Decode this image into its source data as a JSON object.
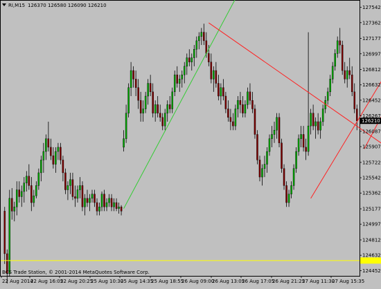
{
  "header": {
    "collapse_icon": "triangle-down-icon",
    "symbol_tf": "RI,M15",
    "ohlc": "126370 126580 126090 126210"
  },
  "footer": {
    "copyright": "BCS Trade Station, © 2001-2014 MetaQuotes Software Corp."
  },
  "colors": {
    "background": "#c0c0c0",
    "bull_candle": "#00aa00",
    "bear_candle": "#800000",
    "wick": "#000000",
    "trendline_green": "#33cc33",
    "trendline_red": "#ff2020",
    "horizontal_line": "#ffff00",
    "price_badge_bg": "#000000",
    "price_badge_text": "#ffffff"
  },
  "chart_data": {
    "type": "candlestick",
    "y_ticks": [
      "127542",
      "127362",
      "127177",
      "126997",
      "126812",
      "126632",
      "126452",
      "126267",
      "126087",
      "125907",
      "125722",
      "125542",
      "125362",
      "125177",
      "124997",
      "124812",
      "124632",
      "124452"
    ],
    "y_range": [
      124390,
      127620
    ],
    "current_price_label": "126210",
    "current_price": 126210,
    "yellow_level": 124570,
    "x_labels": [
      "22 Aug 2014",
      "22 Aug 16:05",
      "22 Aug 20:25",
      "25 Aug 10:30",
      "25 Aug 14:35",
      "25 Aug 18:55",
      "26 Aug 09:00",
      "26 Aug 13:05",
      "26 Aug 17:05",
      "26 Aug 21:25",
      "27 Aug 11:30",
      "27 Aug 15:35"
    ],
    "bars": [
      [
        125150,
        125200,
        124530,
        124650
      ],
      [
        124650,
        124700,
        124300,
        124420
      ],
      [
        124420,
        125400,
        124380,
        125300
      ],
      [
        125300,
        125420,
        125050,
        125150
      ],
      [
        125150,
        125260,
        125030,
        125200
      ],
      [
        125200,
        125500,
        125100,
        125400
      ],
      [
        125400,
        125500,
        125250,
        125320
      ],
      [
        125320,
        125450,
        125200,
        125380
      ],
      [
        125380,
        125550,
        125250,
        125480
      ],
      [
        125480,
        125620,
        125380,
        125560
      ],
      [
        125560,
        125700,
        125400,
        125450
      ],
      [
        125450,
        125550,
        125150,
        125250
      ],
      [
        125250,
        125400,
        125200,
        125330
      ],
      [
        125330,
        125500,
        125300,
        125450
      ],
      [
        125450,
        125650,
        125400,
        125600
      ],
      [
        125600,
        125800,
        125500,
        125750
      ],
      [
        125750,
        125950,
        125600,
        125850
      ],
      [
        125850,
        126050,
        125750,
        126000
      ],
      [
        126000,
        126200,
        125850,
        125900
      ],
      [
        125900,
        126000,
        125750,
        125800
      ],
      [
        125800,
        125900,
        125650,
        125700
      ],
      [
        125700,
        125900,
        125600,
        125850
      ],
      [
        125850,
        125950,
        125750,
        125900
      ],
      [
        125900,
        125950,
        125700,
        125750
      ],
      [
        125750,
        125800,
        125500,
        125600
      ],
      [
        125600,
        125650,
        125350,
        125400
      ],
      [
        125400,
        125500,
        125280,
        125450
      ],
      [
        125450,
        125600,
        125350,
        125520
      ],
      [
        125520,
        125600,
        125280,
        125320
      ],
      [
        125320,
        125450,
        125200,
        125300
      ],
      [
        125300,
        125450,
        125250,
        125400
      ],
      [
        125400,
        125550,
        125300,
        125450
      ],
      [
        125450,
        125500,
        125150,
        125200
      ],
      [
        125200,
        125350,
        125100,
        125300
      ],
      [
        125300,
        125400,
        125200,
        125250
      ],
      [
        125250,
        125350,
        125150,
        125300
      ],
      [
        125300,
        125400,
        125250,
        125350
      ],
      [
        125350,
        125400,
        125200,
        125250
      ],
      [
        125250,
        125300,
        125100,
        125150
      ],
      [
        125150,
        125250,
        125100,
        125200
      ],
      [
        125200,
        125380,
        125150,
        125350
      ],
      [
        125350,
        125400,
        125150,
        125200
      ],
      [
        125200,
        125300,
        125150,
        125250
      ],
      [
        125250,
        125350,
        125200,
        125300
      ],
      [
        125300,
        125350,
        125150,
        125200
      ],
      [
        125200,
        125300,
        125150,
        125250
      ],
      [
        125250,
        125300,
        125150,
        125180
      ],
      [
        125180,
        125250,
        125120,
        125200
      ],
      [
        125200,
        125220,
        125100,
        125150
      ],
      [
        125900,
        126100,
        125850,
        126000
      ],
      [
        126000,
        126400,
        125950,
        126300
      ],
      [
        126300,
        126650,
        126250,
        126600
      ],
      [
        126600,
        126900,
        126500,
        126800
      ],
      [
        126800,
        126850,
        126600,
        126700
      ],
      [
        126700,
        126800,
        126500,
        126600
      ],
      [
        126600,
        126700,
        126350,
        126450
      ],
      [
        126450,
        126550,
        126200,
        126300
      ],
      [
        126300,
        126450,
        126200,
        126350
      ],
      [
        126350,
        126550,
        126300,
        126500
      ],
      [
        126500,
        126700,
        126400,
        126650
      ],
      [
        126650,
        126750,
        126500,
        126550
      ],
      [
        126550,
        126650,
        126250,
        126300
      ],
      [
        126300,
        126450,
        126200,
        126400
      ],
      [
        126400,
        126500,
        126250,
        126300
      ],
      [
        126300,
        126400,
        126200,
        126250
      ],
      [
        126250,
        126300,
        126100,
        126150
      ],
      [
        126150,
        126350,
        126100,
        126300
      ],
      [
        126300,
        126450,
        126200,
        126400
      ],
      [
        126400,
        126500,
        126300,
        126350
      ],
      [
        126350,
        126600,
        126300,
        126550
      ],
      [
        126550,
        126800,
        126500,
        126750
      ],
      [
        126750,
        126850,
        126600,
        126650
      ],
      [
        126650,
        126750,
        126550,
        126700
      ],
      [
        126700,
        126800,
        126600,
        126750
      ],
      [
        126750,
        126900,
        126650,
        126850
      ],
      [
        126850,
        127000,
        126750,
        126950
      ],
      [
        126950,
        127050,
        126850,
        126900
      ],
      [
        126900,
        127000,
        126800,
        126950
      ],
      [
        126950,
        127100,
        126850,
        127050
      ],
      [
        127050,
        127200,
        126950,
        127150
      ],
      [
        127150,
        127250,
        127050,
        127200
      ],
      [
        127200,
        127300,
        127100,
        127250
      ],
      [
        127250,
        127350,
        127100,
        127150
      ],
      [
        127150,
        127250,
        126950,
        127000
      ],
      [
        127000,
        127100,
        126850,
        126900
      ],
      [
        126900,
        127000,
        126650,
        126700
      ],
      [
        126700,
        126850,
        126550,
        126800
      ],
      [
        126800,
        126900,
        126600,
        126650
      ],
      [
        126650,
        126750,
        126450,
        126500
      ],
      [
        126500,
        126650,
        126400,
        126600
      ],
      [
        126600,
        126700,
        126450,
        126500
      ],
      [
        126500,
        126550,
        126300,
        126350
      ],
      [
        126350,
        126450,
        126200,
        126250
      ],
      [
        126250,
        126350,
        126100,
        126200
      ],
      [
        126200,
        126300,
        126100,
        126150
      ],
      [
        126150,
        126400,
        126100,
        126350
      ],
      [
        126350,
        126500,
        126250,
        126450
      ],
      [
        126450,
        126550,
        126300,
        126400
      ],
      [
        126400,
        126500,
        126250,
        126300
      ],
      [
        126300,
        126450,
        126250,
        126400
      ],
      [
        126400,
        126600,
        126350,
        126550
      ],
      [
        126550,
        126650,
        126400,
        126450
      ],
      [
        126450,
        126550,
        126300,
        126350
      ],
      [
        126350,
        126400,
        126000,
        126050
      ],
      [
        126050,
        126100,
        125700,
        125750
      ],
      [
        125750,
        125800,
        125500,
        125550
      ],
      [
        125550,
        125700,
        125450,
        125650
      ],
      [
        125650,
        125800,
        125550,
        125700
      ],
      [
        125700,
        125900,
        125600,
        125850
      ],
      [
        125850,
        126050,
        125800,
        126000
      ],
      [
        126000,
        126150,
        125900,
        126050
      ],
      [
        126050,
        126200,
        125950,
        126100
      ],
      [
        126100,
        126300,
        126000,
        126250
      ],
      [
        126250,
        126300,
        125900,
        125950
      ],
      [
        125950,
        126000,
        125600,
        125650
      ],
      [
        125650,
        125700,
        125400,
        125450
      ],
      [
        125450,
        125500,
        125200,
        125250
      ],
      [
        125250,
        125400,
        125200,
        125350
      ],
      [
        125350,
        125500,
        125300,
        125450
      ],
      [
        125450,
        125700,
        125400,
        125650
      ],
      [
        125650,
        125900,
        125600,
        125850
      ],
      [
        125850,
        126050,
        125800,
        126000
      ],
      [
        126000,
        126150,
        125900,
        126050
      ],
      [
        126050,
        126150,
        125850,
        125900
      ],
      [
        125900,
        126000,
        125750,
        125850
      ],
      [
        125850,
        127250,
        125800,
        126150
      ],
      [
        126150,
        126350,
        126050,
        126300
      ],
      [
        126300,
        126400,
        126100,
        126150
      ],
      [
        126150,
        126250,
        126000,
        126200
      ],
      [
        126200,
        126300,
        126050,
        126100
      ],
      [
        126100,
        126250,
        126000,
        126200
      ],
      [
        126200,
        126400,
        126150,
        126350
      ],
      [
        126350,
        126500,
        126300,
        126450
      ],
      [
        126450,
        126600,
        126400,
        126550
      ],
      [
        126550,
        126750,
        126500,
        126700
      ],
      [
        126700,
        126900,
        126650,
        126850
      ],
      [
        126850,
        127050,
        126800,
        127000
      ],
      [
        127000,
        127200,
        126950,
        127150
      ],
      [
        127150,
        127300,
        127000,
        127100
      ],
      [
        127100,
        127150,
        126750,
        126800
      ],
      [
        126800,
        126900,
        126650,
        126700
      ],
      [
        126700,
        126850,
        126600,
        126800
      ],
      [
        126800,
        126950,
        126700,
        126750
      ],
      [
        126750,
        126850,
        126500,
        126550
      ],
      [
        126550,
        126650,
        126300,
        126350
      ],
      [
        126350,
        126400,
        126100,
        126210
      ]
    ],
    "trendlines": [
      {
        "color": "green",
        "from": {
          "bar": 49,
          "price": 125180
        },
        "to": {
          "bar": 97,
          "price": 127750
        }
      },
      {
        "color": "red",
        "from": {
          "bar": 84,
          "price": 127360
        },
        "to": {
          "bar": 170,
          "price": 125650
        }
      },
      {
        "color": "red",
        "from": {
          "bar": 126,
          "price": 125300
        },
        "to": {
          "bar": 170,
          "price": 127380
        }
      },
      {
        "color": "red",
        "from": {
          "bar": 148,
          "price": 125880
        },
        "to": {
          "bar": 166,
          "price": 126850
        }
      },
      {
        "color": "red",
        "from": {
          "bar": 158,
          "price": 126900
        },
        "to": {
          "bar": 170,
          "price": 126300
        }
      }
    ]
  }
}
